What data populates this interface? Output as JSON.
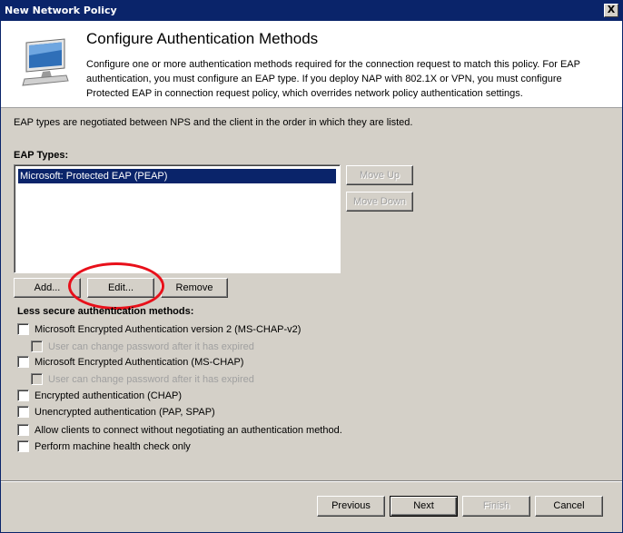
{
  "window": {
    "title": "New Network Policy",
    "close_label": "X"
  },
  "header": {
    "title": "Configure Authentication Methods",
    "description": "Configure one or more authentication methods required for the connection request to match this policy. For EAP authentication, you must configure an EAP type. If you deploy NAP with 802.1X or VPN, you must configure Protected EAP in connection request policy, which overrides network policy authentication settings.",
    "icon": "computer-monitor-icon"
  },
  "intro_text": "EAP types are negotiated between NPS and the client in the order in which they are listed.",
  "eap": {
    "label": "EAP Types:",
    "items": [
      "Microsoft: Protected EAP (PEAP)"
    ],
    "move_up": "Move Up",
    "move_down": "Move Down",
    "add": "Add...",
    "edit": "Edit...",
    "remove": "Remove"
  },
  "less_secure": {
    "label": "Less secure authentication methods:",
    "options": [
      {
        "label": "Microsoft Encrypted Authentication version 2 (MS-CHAP-v2)",
        "checked": false,
        "enabled": true
      },
      {
        "label": "User can change password after it has expired",
        "checked": false,
        "enabled": false
      },
      {
        "label": "Microsoft Encrypted Authentication (MS-CHAP)",
        "checked": false,
        "enabled": true
      },
      {
        "label": "User can change password after it has expired",
        "checked": false,
        "enabled": false
      },
      {
        "label": "Encrypted authentication (CHAP)",
        "checked": false,
        "enabled": true
      },
      {
        "label": "Unencrypted authentication (PAP, SPAP)",
        "checked": false,
        "enabled": true
      },
      {
        "label": "Allow clients to connect without negotiating an authentication method.",
        "checked": false,
        "enabled": true
      },
      {
        "label": "Perform machine health check only",
        "checked": false,
        "enabled": true
      }
    ]
  },
  "footer": {
    "previous": "Previous",
    "next": "Next",
    "finish": "Finish",
    "cancel": "Cancel"
  },
  "colors": {
    "titlebar": "#0a246a",
    "face": "#d4d0c8",
    "highlight_oval": "#e8101a"
  }
}
